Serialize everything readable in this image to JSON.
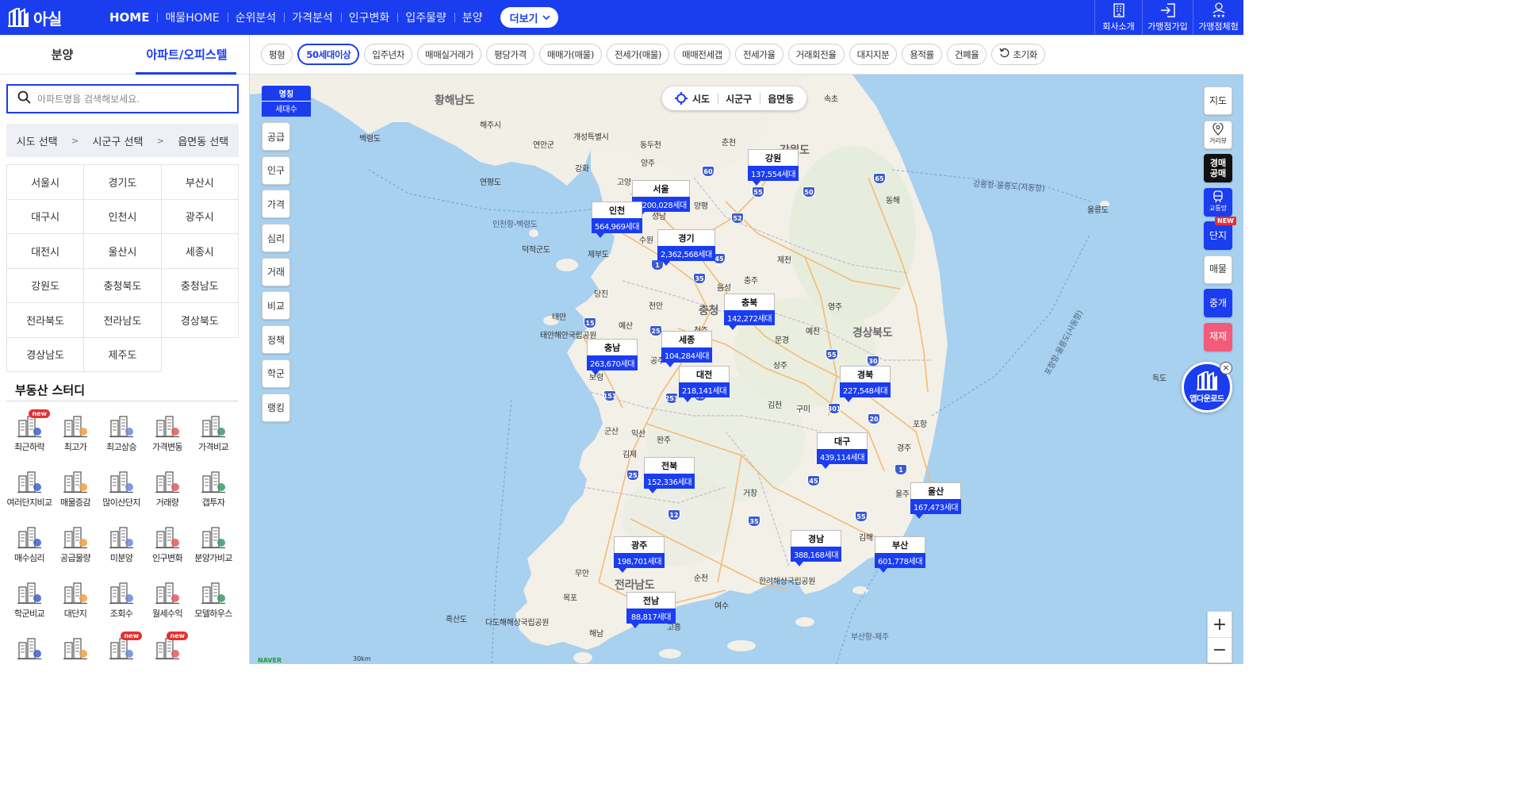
{
  "brand": {
    "name": "아실"
  },
  "nav": {
    "items": [
      "HOME",
      "매물HOME",
      "순위분석",
      "가격분석",
      "인구변화",
      "입주물량",
      "분양"
    ],
    "more": "더보기"
  },
  "top_right": [
    {
      "label": "회사소개",
      "icon": "building-icon"
    },
    {
      "label": "가맹점가입",
      "icon": "login-icon"
    },
    {
      "label": "가맹점체험",
      "icon": "user-star-icon"
    }
  ],
  "sidebar": {
    "tabs": [
      {
        "label": "분양",
        "active": false
      },
      {
        "label": "아파트/오피스텔",
        "active": true
      }
    ],
    "search": {
      "placeholder": "아파트명을 검색해보세요."
    },
    "region_path": [
      "시도 선택",
      "시군구 선택",
      "읍면동 선택"
    ],
    "region_sep": ">",
    "regions": [
      "서울시",
      "경기도",
      "부산시",
      "대구시",
      "인천시",
      "광주시",
      "대전시",
      "울산시",
      "세종시",
      "강원도",
      "충청북도",
      "충청남도",
      "전라북도",
      "전라남도",
      "경상북도",
      "경상남도",
      "제주도"
    ],
    "study_title": "부동산 스터디",
    "study_items": [
      {
        "label": "최근하락",
        "new": true
      },
      {
        "label": "최고가",
        "new": false
      },
      {
        "label": "최고상승",
        "new": false
      },
      {
        "label": "가격변동",
        "new": false
      },
      {
        "label": "가격비교",
        "new": false
      },
      {
        "label": "여러단지비교",
        "new": false
      },
      {
        "label": "매물증감",
        "new": false
      },
      {
        "label": "많이산단지",
        "new": false
      },
      {
        "label": "거래량",
        "new": false
      },
      {
        "label": "갭투자",
        "new": false
      },
      {
        "label": "매수심리",
        "new": false
      },
      {
        "label": "공급물량",
        "new": false
      },
      {
        "label": "미분양",
        "new": false
      },
      {
        "label": "인구변화",
        "new": false
      },
      {
        "label": "분양가비교",
        "new": false
      },
      {
        "label": "학군비교",
        "new": false
      },
      {
        "label": "대단지",
        "new": false
      },
      {
        "label": "조회수",
        "new": false
      },
      {
        "label": "월세수익",
        "new": false
      },
      {
        "label": "모델하우스",
        "new": false
      },
      {
        "label": "",
        "new": false
      },
      {
        "label": "",
        "new": false
      },
      {
        "label": "",
        "new": true
      },
      {
        "label": "",
        "new": true
      }
    ],
    "new_badge": "new"
  },
  "filters": {
    "chips": [
      {
        "label": "평형",
        "active": false
      },
      {
        "label": "50세대이상",
        "active": true
      },
      {
        "label": "입주년차",
        "active": false
      },
      {
        "label": "매매실거래가",
        "active": false
      },
      {
        "label": "평당가격",
        "active": false
      },
      {
        "label": "매매가(매물)",
        "active": false
      },
      {
        "label": "전세가(매물)",
        "active": false
      },
      {
        "label": "매매전세갭",
        "active": false
      },
      {
        "label": "전세가율",
        "active": false
      },
      {
        "label": "거래회전율",
        "active": false
      },
      {
        "label": "대지지분",
        "active": false
      },
      {
        "label": "용적률",
        "active": false
      },
      {
        "label": "건폐율",
        "active": false
      }
    ],
    "reset": "초기화"
  },
  "map": {
    "legend": {
      "top": "명칭",
      "bottom": "세대수"
    },
    "left_tools": [
      "공급",
      "인구",
      "가격",
      "심리",
      "거래",
      "비교",
      "정책",
      "학군",
      "랭킹"
    ],
    "level_toggle": [
      "시도",
      "시군구",
      "읍면동"
    ],
    "right_tools": {
      "map": "지도",
      "street": "거리뷰",
      "auction": "경매\n공매",
      "transit": "교통망",
      "complex": "단지",
      "complex_new": "NEW",
      "listing": "매물",
      "broker": "중개",
      "redevelop": "재재"
    },
    "app_download": "앱다운로드",
    "markers": [
      {
        "id": "seoul",
        "name": "서울",
        "count": "1,200,028세대"
      },
      {
        "id": "incheon",
        "name": "인천",
        "count": "564,969세대"
      },
      {
        "id": "gyeonggi",
        "name": "경기",
        "count": "2,362,568세대"
      },
      {
        "id": "gangwon",
        "name": "강원",
        "count": "137,554세대"
      },
      {
        "id": "chungbuk",
        "name": "충북",
        "count": "142,272세대"
      },
      {
        "id": "sejong",
        "name": "세종",
        "count": "104,284세대"
      },
      {
        "id": "chungnam",
        "name": "충남",
        "count": "263,670세대"
      },
      {
        "id": "daejeon",
        "name": "대전",
        "count": "218,141세대"
      },
      {
        "id": "gyeongbuk",
        "name": "경북",
        "count": "227,548세대"
      },
      {
        "id": "daegu",
        "name": "대구",
        "count": "439,114세대"
      },
      {
        "id": "jeonbuk",
        "name": "전북",
        "count": "152,336세대"
      },
      {
        "id": "ulsan",
        "name": "울산",
        "count": "167,473세대"
      },
      {
        "id": "gwangju",
        "name": "광주",
        "count": "198,701세대"
      },
      {
        "id": "gyeongnam",
        "name": "경남",
        "count": "388,168세대"
      },
      {
        "id": "busan",
        "name": "부산",
        "count": "601,778세대"
      },
      {
        "id": "jeonnam",
        "name": "전남",
        "count": "88,817세대"
      }
    ],
    "places": {
      "hwanghae": "황해남도",
      "haeju": "해주시",
      "baengnyeong": "백령도",
      "yeonan": "연안군",
      "kaesong": "개성특별시",
      "ganghwa": "강화",
      "yangju": "양주",
      "dongducheon": "동두천",
      "chuncheon": "춘천",
      "gangwon_do": "강원도",
      "sokcho": "속초",
      "yeonpyeong": "연평도",
      "goyang": "고양",
      "yangpyeong": "양평",
      "seongnam": "성남",
      "suwon": "수원",
      "jebudo": "제부도",
      "deokjeok": "덕적군도",
      "jecheon": "제천",
      "eumseong": "음성",
      "chungju": "충주",
      "yeongju": "영주",
      "dangjin": "당진",
      "cheonan": "천안",
      "taean": "태안",
      "yesan": "예산",
      "chungcheong": "충청",
      "cheongju": "청주",
      "gongju": "공주",
      "mungyeong": "문경",
      "yecheon": "예천",
      "gyeongsangbukdo": "경상북도",
      "boryeong": "보령",
      "sangju": "상주",
      "gimcheon": "김천",
      "gumi": "구미",
      "pohang": "포항",
      "gunsan": "군산",
      "iksan": "익산",
      "wanju": "완주",
      "gimje": "김제",
      "geochang": "거창",
      "gyeongju": "경주",
      "ulju": "울주",
      "gimhae": "김해",
      "muan": "무안",
      "suncheon": "순천",
      "jeollanamdo": "전라남도",
      "yeosu": "여수",
      "mokpo": "목포",
      "heuksando": "흑산도",
      "haenam": "해남",
      "goheung": "고흥",
      "donghae": "동해",
      "ulleung": "울릉도",
      "dokdo": "독도",
      "tanning": "태안해안국립공원",
      "dadohae": "다도해해상국립공원",
      "hallyeo": "한려해상국립공원",
      "route_incheon": "인천항-백령도",
      "route_ulleung": "강릉항-울릉도(저동항)",
      "route_busan": "부산항-제주",
      "sea_line": "포항항-울릉도(사동항)"
    },
    "attribution": {
      "provider": "NAVER",
      "scale": "30km"
    }
  }
}
